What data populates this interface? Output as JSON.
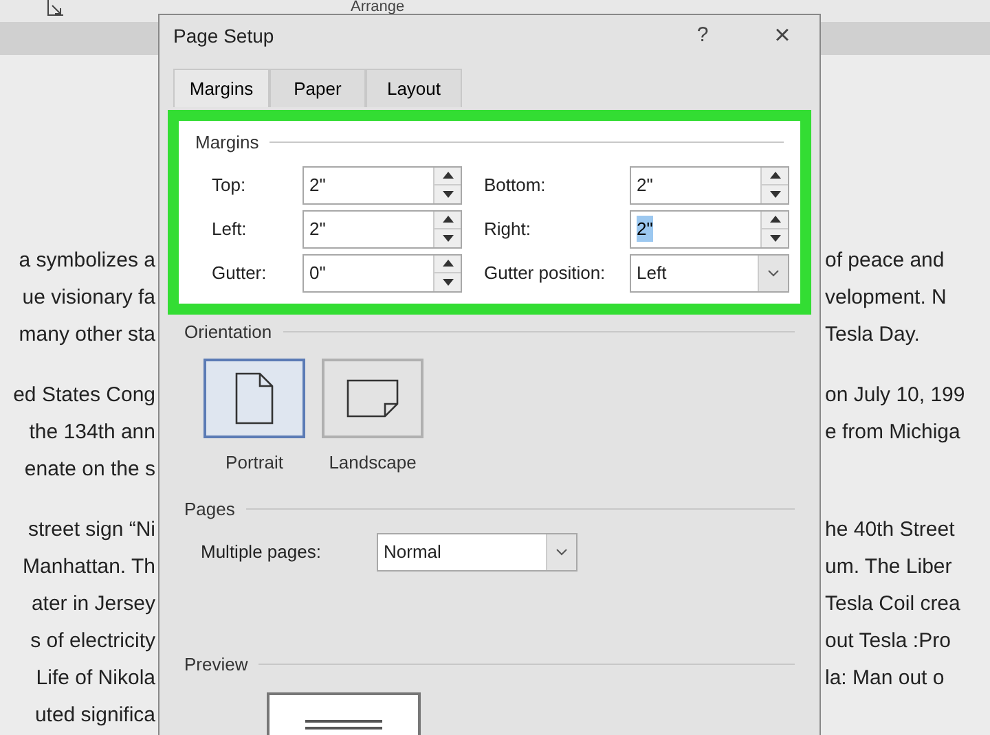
{
  "ribbon": {
    "group_label": "Arrange"
  },
  "document": {
    "left_paragraphs": [
      [
        "a symbolizes a",
        "ue visionary fa",
        "many other sta"
      ],
      [
        "ed States Cong",
        "the 134th ann",
        "enate on the s"
      ],
      [
        "street sign “Ni",
        "Manhattan. Th",
        "ater in Jersey",
        "s of electricity",
        "Life of Nikola",
        "uted significa"
      ]
    ],
    "right_paragraphs": [
      [
        "of peace and",
        "velopment. N",
        "Tesla Day."
      ],
      [
        "on July 10, 199",
        "e from Michiga"
      ],
      [
        "he 40th Street",
        "um. The Liber",
        "Tesla Coil crea",
        "out Tesla :Pro",
        "la: Man out o"
      ]
    ]
  },
  "dialog": {
    "title": "Page Setup",
    "help": "?",
    "close": "×",
    "tabs": [
      {
        "label": "Margins",
        "selected": true
      },
      {
        "label": "Paper",
        "selected": false
      },
      {
        "label": "Layout",
        "selected": false
      }
    ],
    "margins": {
      "label": "Margins",
      "highlighted": true,
      "fields": [
        {
          "kind": "spin",
          "label": "Top:",
          "value": "2\"",
          "text_selected": false
        },
        {
          "kind": "spin",
          "label": "Bottom:",
          "value": "2\"",
          "text_selected": false
        },
        {
          "kind": "spin",
          "label": "Left:",
          "value": "2\"",
          "text_selected": false
        },
        {
          "kind": "spin",
          "label": "Right:",
          "value": "2\"",
          "text_selected": true
        },
        {
          "kind": "spin",
          "label": "Gutter:",
          "value": "0\"",
          "text_selected": false
        },
        {
          "kind": "select",
          "label": "Gutter position:",
          "value": "Left",
          "text_selected": false
        }
      ]
    },
    "orientation": {
      "label": "Orientation",
      "options": [
        {
          "kind": "portrait",
          "label": "Portrait",
          "selected": true
        },
        {
          "kind": "landscape",
          "label": "Landscape",
          "selected": false
        }
      ]
    },
    "pages": {
      "label": "Pages",
      "multiple_pages": {
        "label": "Multiple pages:",
        "value": "Normal"
      }
    },
    "preview": {
      "label": "Preview"
    }
  }
}
